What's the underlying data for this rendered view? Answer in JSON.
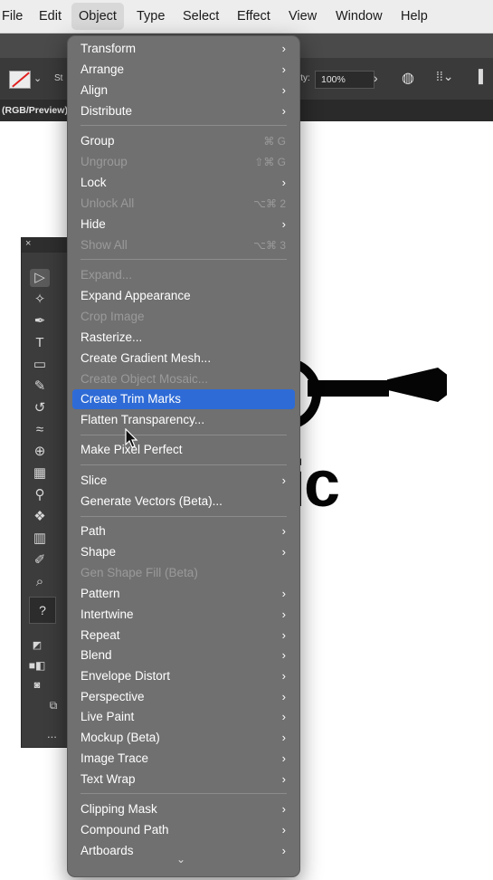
{
  "menubar": {
    "items": [
      "File",
      "Edit",
      "Object",
      "Type",
      "Select",
      "Effect",
      "View",
      "Window",
      "Help"
    ],
    "active": "Object"
  },
  "toolbar": {
    "stroke_label": "St",
    "opacity_label": "ity:",
    "opacity_value": "100%",
    "doc_tab": "(RGB/Preview)"
  },
  "artwork": {
    "text": "ic"
  },
  "tools_panel": {
    "help_tool": "?",
    "more_label": "..."
  },
  "object_menu": {
    "items": [
      {
        "label": "Transform",
        "submenu": true,
        "enabled": true
      },
      {
        "label": "Arrange",
        "submenu": true,
        "enabled": true
      },
      {
        "label": "Align",
        "submenu": true,
        "enabled": true
      },
      {
        "label": "Distribute",
        "submenu": true,
        "enabled": true
      },
      {
        "label": "Group",
        "shortcut": "⌘ G",
        "enabled": true
      },
      {
        "label": "Ungroup",
        "shortcut": "⇧⌘ G",
        "enabled": false
      },
      {
        "label": "Lock",
        "submenu": true,
        "enabled": true
      },
      {
        "label": "Unlock All",
        "shortcut": "⌥⌘ 2",
        "enabled": false
      },
      {
        "label": "Hide",
        "submenu": true,
        "enabled": true
      },
      {
        "label": "Show All",
        "shortcut": "⌥⌘ 3",
        "enabled": false
      },
      {
        "label": "Expand...",
        "enabled": false
      },
      {
        "label": "Expand Appearance",
        "enabled": true
      },
      {
        "label": "Crop Image",
        "enabled": false
      },
      {
        "label": "Rasterize...",
        "enabled": true
      },
      {
        "label": "Create Gradient Mesh...",
        "enabled": true
      },
      {
        "label": "Create Object Mosaic...",
        "enabled": false
      },
      {
        "label": "Create Trim Marks",
        "enabled": true,
        "highlighted": true
      },
      {
        "label": "Flatten Transparency...",
        "enabled": true
      },
      {
        "label": "Make Pixel Perfect",
        "enabled": true
      },
      {
        "label": "Slice",
        "submenu": true,
        "enabled": true
      },
      {
        "label": "Generate Vectors (Beta)...",
        "enabled": true
      },
      {
        "label": "Path",
        "submenu": true,
        "enabled": true
      },
      {
        "label": "Shape",
        "submenu": true,
        "enabled": true
      },
      {
        "label": "Gen Shape Fill (Beta)",
        "enabled": false
      },
      {
        "label": "Pattern",
        "submenu": true,
        "enabled": true
      },
      {
        "label": "Intertwine",
        "submenu": true,
        "enabled": true
      },
      {
        "label": "Repeat",
        "submenu": true,
        "enabled": true
      },
      {
        "label": "Blend",
        "submenu": true,
        "enabled": true
      },
      {
        "label": "Envelope Distort",
        "submenu": true,
        "enabled": true
      },
      {
        "label": "Perspective",
        "submenu": true,
        "enabled": true
      },
      {
        "label": "Live Paint",
        "submenu": true,
        "enabled": true
      },
      {
        "label": "Mockup (Beta)",
        "submenu": true,
        "enabled": true
      },
      {
        "label": "Image Trace",
        "submenu": true,
        "enabled": true
      },
      {
        "label": "Text Wrap",
        "submenu": true,
        "enabled": true
      },
      {
        "label": "Clipping Mask",
        "submenu": true,
        "enabled": true
      },
      {
        "label": "Compound Path",
        "submenu": true,
        "enabled": true
      },
      {
        "label": "Artboards",
        "submenu": true,
        "enabled": true
      }
    ],
    "arrow_glyph": "›",
    "scroll_more_glyph": "⌄"
  },
  "colors": {
    "menu_bg": "#707070",
    "highlight": "#2e6bd6",
    "disabled_text": "#9a9a9a"
  }
}
